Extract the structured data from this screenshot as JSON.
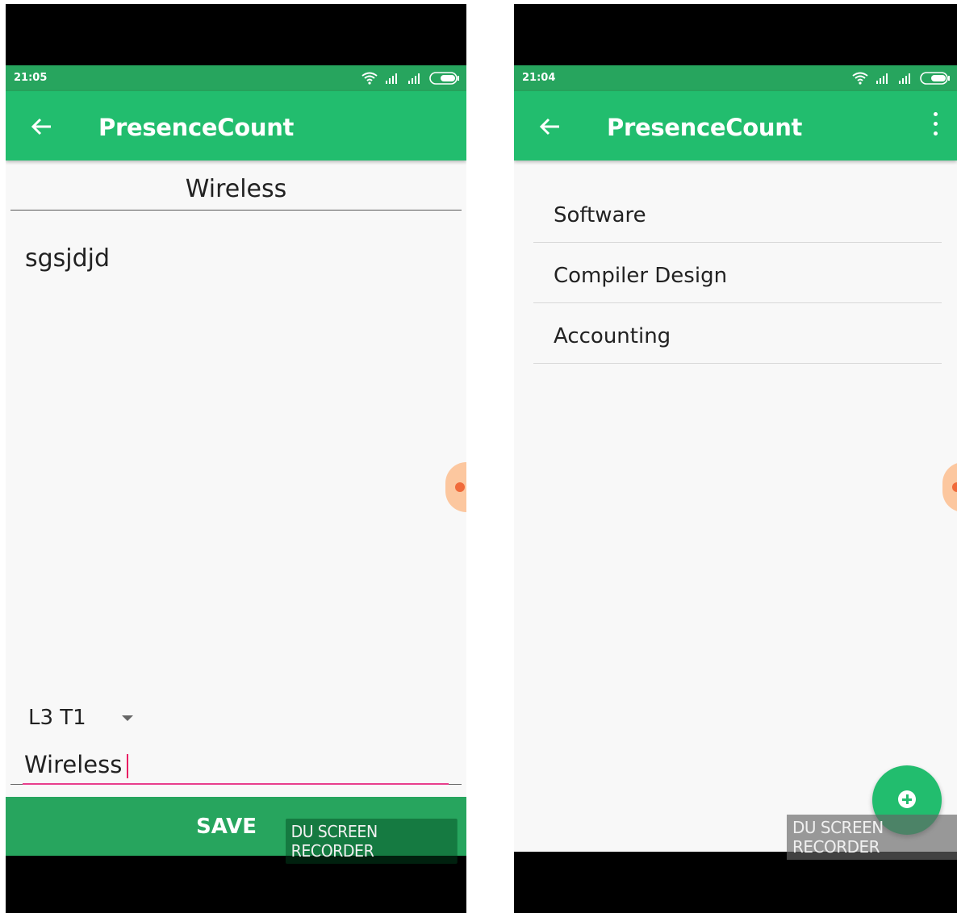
{
  "left": {
    "status": {
      "time": "21:05"
    },
    "appbar": {
      "title": "PresenceCount"
    },
    "subject_heading": "Wireless",
    "note_text": "sgsjdjd",
    "dropdown": {
      "selected": "L3 T1"
    },
    "text_field": {
      "value": "Wireless"
    },
    "bottom": {
      "save_label": "SAVE",
      "watermark": "DU SCREEN RECORDER"
    }
  },
  "right": {
    "status": {
      "time": "21:04"
    },
    "appbar": {
      "title": "PresenceCount"
    },
    "subjects": [
      {
        "label": "Software"
      },
      {
        "label": "Compiler Design"
      },
      {
        "label": "Accounting"
      }
    ],
    "watermark": "DU SCREEN RECORDER"
  },
  "colors": {
    "status_bar": "#27a55e",
    "app_bar": "#22bd6e",
    "accent": "#e83e8c",
    "background": "#f8f8f8"
  },
  "icons": [
    "back-arrow-icon",
    "wifi-icon",
    "signal-icon",
    "battery-icon",
    "overflow-menu-icon",
    "add-icon",
    "dropdown-arrow-icon"
  ]
}
